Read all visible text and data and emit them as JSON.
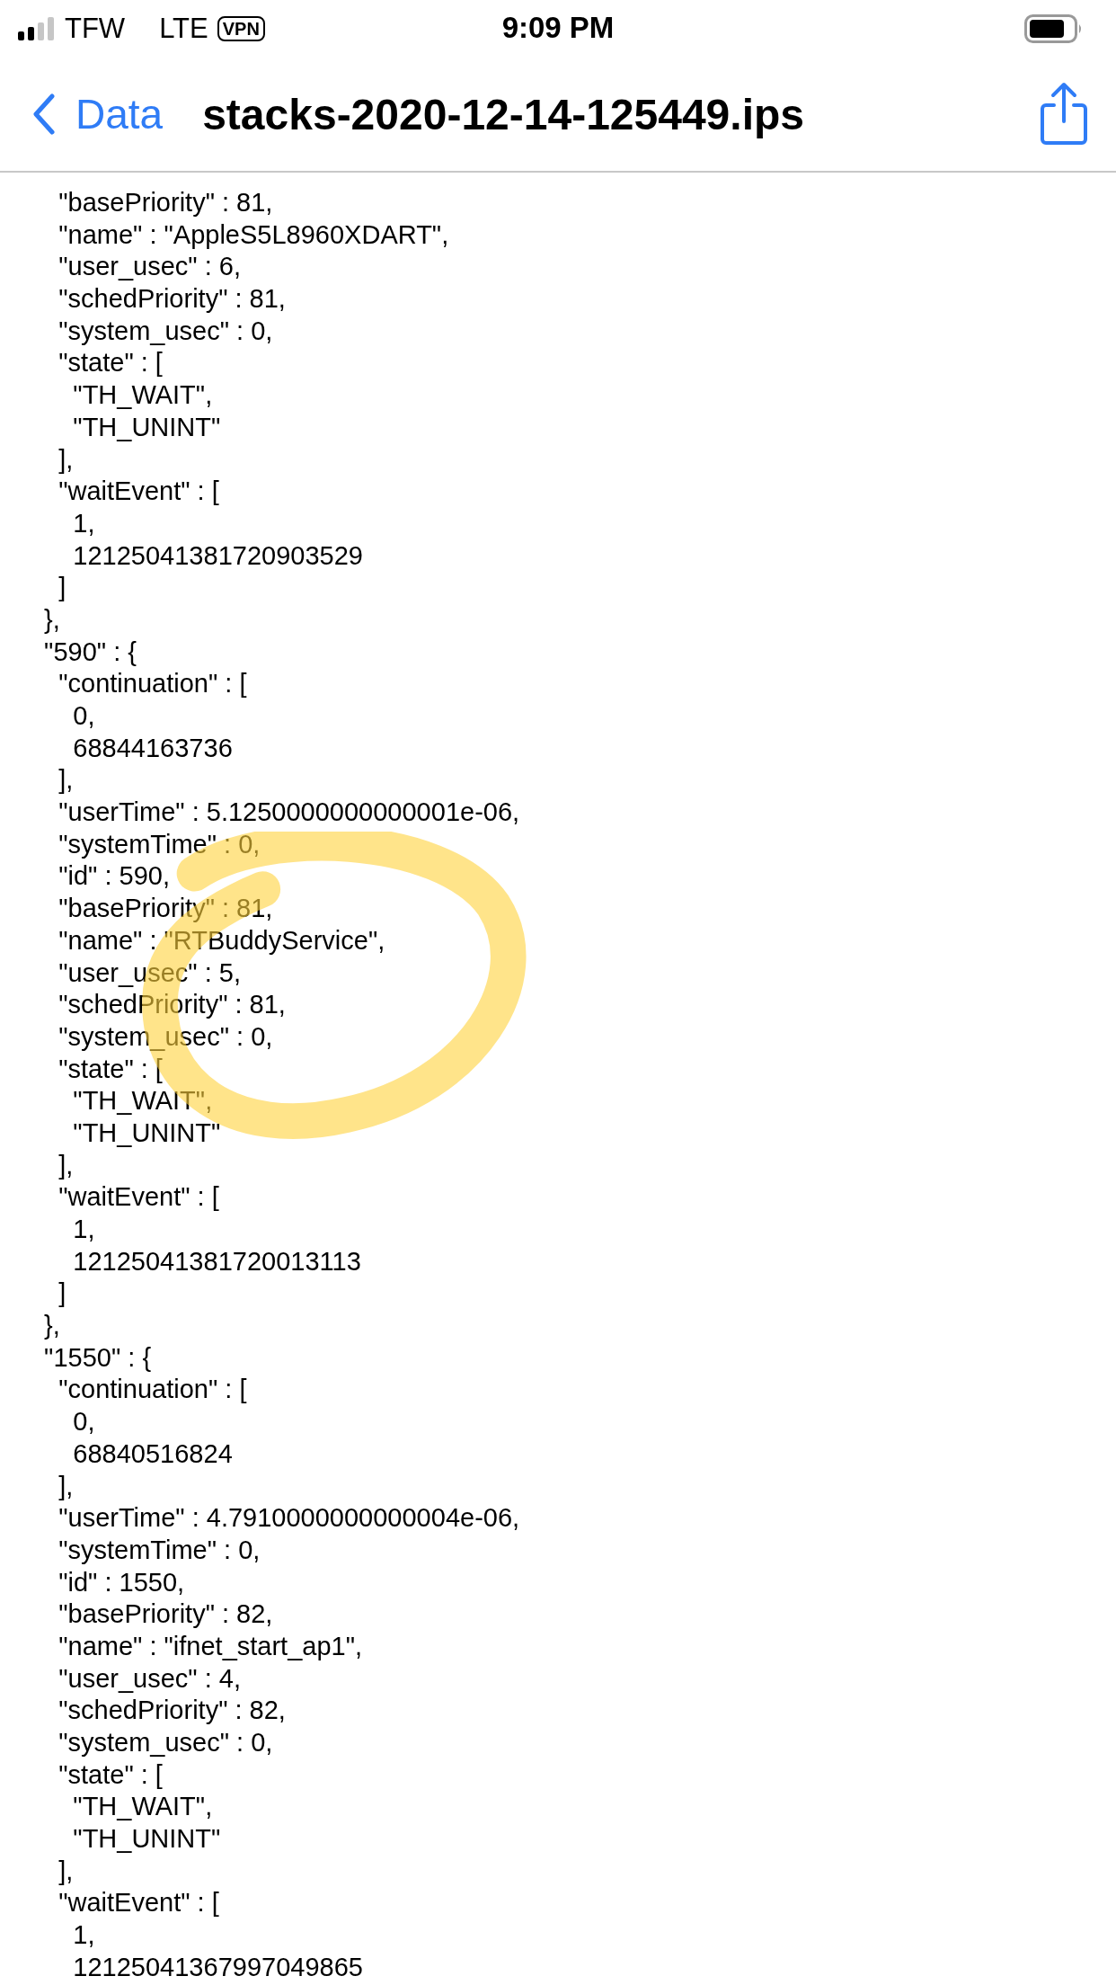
{
  "status_bar": {
    "carrier": "TFW",
    "network": "LTE",
    "vpn": "VPN",
    "time": "9:09 PM"
  },
  "nav": {
    "back": "Data",
    "title": "stacks-2020-12-14-125449.ips"
  },
  "lines": [
    "    \"basePriority\" : 81,",
    "    \"name\" : \"AppleS5L8960XDART\",",
    "    \"user_usec\" : 6,",
    "    \"schedPriority\" : 81,",
    "    \"system_usec\" : 0,",
    "    \"state\" : [",
    "      \"TH_WAIT\",",
    "      \"TH_UNINT\"",
    "    ],",
    "    \"waitEvent\" : [",
    "      1,",
    "      12125041381720903529",
    "    ]",
    "  },",
    "  \"590\" : {",
    "    \"continuation\" : [",
    "      0,",
    "      68844163736",
    "    ],",
    "    \"userTime\" : 5.1250000000000001e-06,",
    "    \"systemTime\" : 0,",
    "    \"id\" : 590,",
    "    \"basePriority\" : 81,",
    "    \"name\" : \"RTBuddyService\",",
    "    \"user_usec\" : 5,",
    "    \"schedPriority\" : 81,",
    "    \"system_usec\" : 0,",
    "    \"state\" : [",
    "      \"TH_WAIT\",",
    "      \"TH_UNINT\"",
    "    ],",
    "    \"waitEvent\" : [",
    "      1,",
    "      12125041381720013113",
    "    ]",
    "  },",
    "  \"1550\" : {",
    "    \"continuation\" : [",
    "      0,",
    "      68840516824",
    "    ],",
    "    \"userTime\" : 4.7910000000000004e-06,",
    "    \"systemTime\" : 0,",
    "    \"id\" : 1550,",
    "    \"basePriority\" : 82,",
    "    \"name\" : \"ifnet_start_ap1\",",
    "    \"user_usec\" : 4,",
    "    \"schedPriority\" : 82,",
    "    \"system_usec\" : 0,",
    "    \"state\" : [",
    "      \"TH_WAIT\",",
    "      \"TH_UNINT\"",
    "    ],",
    "    \"waitEvent\" : [",
    "      1,",
    "      12125041367997049865"
  ]
}
